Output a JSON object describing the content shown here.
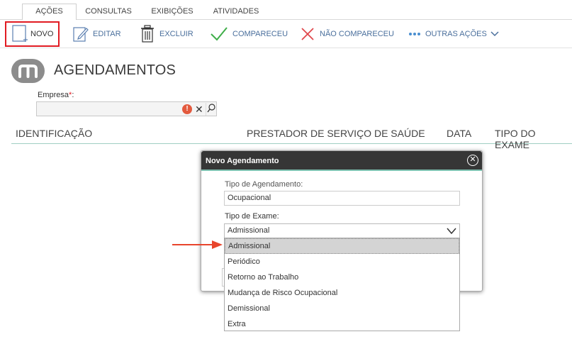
{
  "tabs": [
    {
      "label": "AÇÕES",
      "active": true
    },
    {
      "label": "CONSULTAS",
      "active": false
    },
    {
      "label": "EXIBIÇÕES",
      "active": false
    },
    {
      "label": "ATIVIDADES",
      "active": false
    }
  ],
  "toolbar": {
    "novo": "NOVO",
    "editar": "EDITAR",
    "excluir": "EXCLUIR",
    "compareceu": "COMPARECEU",
    "nao_compareceu": "NÃO COMPARECEU",
    "outras_acoes": "OUTRAS AÇÕES"
  },
  "page": {
    "title": "AGENDAMENTOS"
  },
  "empresa": {
    "label": "Empresa",
    "required_mark": "*",
    "suffix": ":",
    "value": ""
  },
  "grid": {
    "columns": [
      "IDENTIFICAÇÃO",
      "PRESTADOR DE SERVIÇO DE SAÚDE",
      "DATA",
      "TIPO DO EXAME"
    ]
  },
  "modal": {
    "title": "Novo Agendamento",
    "tipo_agendamento_label": "Tipo de Agendamento:",
    "tipo_agendamento_value": "Ocupacional",
    "tipo_exame_label": "Tipo de Exame:",
    "tipo_exame_value": "Admissional"
  },
  "dropdown": {
    "options": [
      "Admissional",
      "Periódico",
      "Retorno ao Trabalho",
      "Mudança de Risco Ocupacional",
      "Demissional",
      "Extra"
    ],
    "selected_index": 0
  },
  "colors": {
    "accent_red": "#e11b22",
    "link_blue": "#4a6f9c",
    "check_green": "#3fae49",
    "modal_header": "#363636",
    "teal_border": "#7fc3b2"
  }
}
